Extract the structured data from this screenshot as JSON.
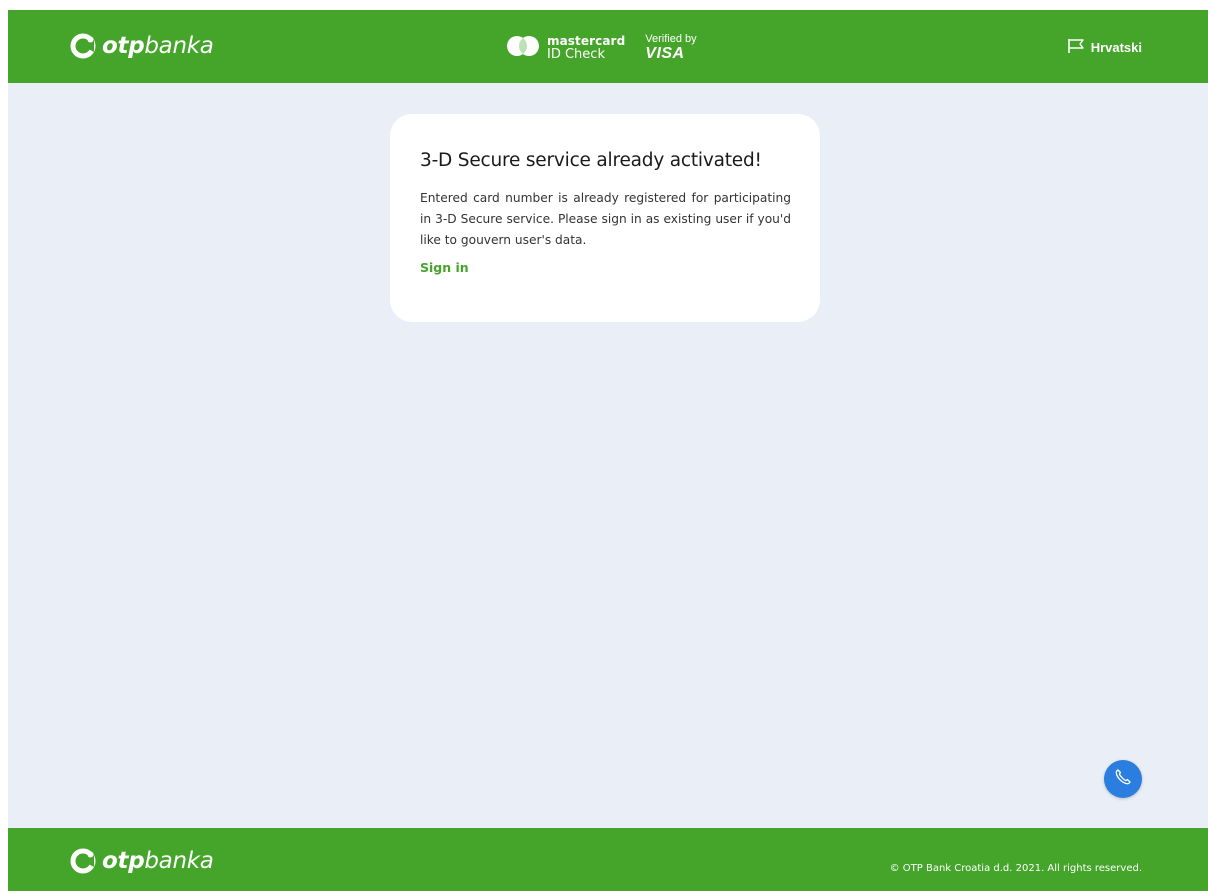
{
  "header": {
    "logo": {
      "brand_bold": "otp",
      "brand_light": "banka"
    },
    "mastercard": {
      "line1": "mastercard",
      "line2": "ID Check"
    },
    "visa": {
      "line1": "Verified by",
      "line2": "VISA"
    },
    "language_label": "Hrvatski"
  },
  "card": {
    "title": "3-D Secure service already activated!",
    "body": "Entered card number is already registered for participating in 3-D Secure service. Please sign in as existing user if you'd like to gouvern user's data.",
    "link_label": "Sign in"
  },
  "footer": {
    "logo": {
      "brand_bold": "otp",
      "brand_light": "banka"
    },
    "copyright": "© OTP Bank Croatia d.d. 2021. All rights reserved."
  },
  "colors": {
    "brand_green": "#45a52a",
    "page_background": "#e9eef7",
    "call_button": "#2b7de0"
  },
  "icons": {
    "logo": "otp-swirl-icon",
    "language": "flag-icon",
    "mastercard": "mastercard-circles-icon",
    "call": "phone-icon"
  }
}
